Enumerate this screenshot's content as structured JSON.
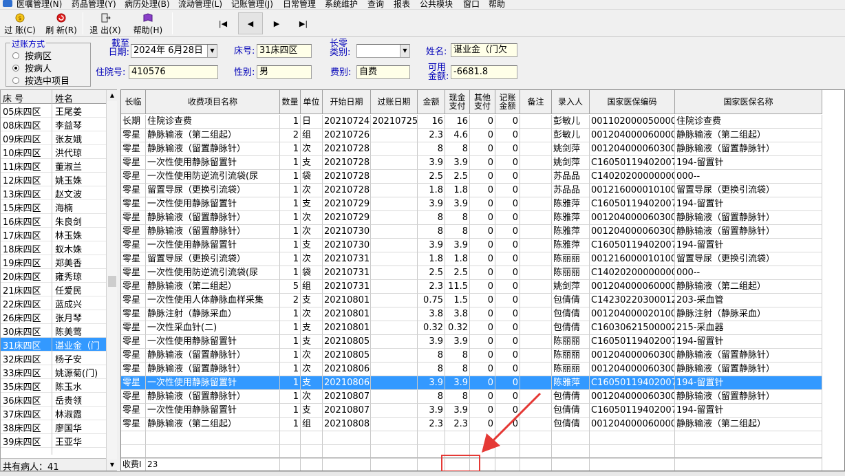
{
  "menu": [
    "医嘱管理(N)",
    "药品管理(Y)",
    "病历处理(B)",
    "流动管理(L)",
    "记账管理(J)",
    "日常管理",
    "系统维护",
    "查询",
    "报表",
    "公共模块",
    "窗口",
    "帮助"
  ],
  "toolbar": {
    "post_label": "过 账(C)",
    "refresh_label": "刷 新(R)",
    "exit_label": "退 出(X)",
    "help_label": "帮助(H)",
    "nav_first": "|◀",
    "nav_prev": "◀",
    "nav_next": "▶",
    "nav_last": "▶|"
  },
  "filters": {
    "mode_title": "过账方式",
    "mode_options": [
      "按病区",
      "按病人",
      "按选中项目"
    ],
    "mode_selected": 1,
    "cutoff_label": "截至日期:",
    "cutoff_value": "2024年 6月28日",
    "bed_label": "床号:",
    "bed_value": "31床四区",
    "longterm_label": "长零类别:",
    "longterm_value": "",
    "name_label": "姓名:",
    "name_value": "谌业金（门欠",
    "inpatient_label": "住院号:",
    "inpatient_value": "410576",
    "gender_label": "性别:",
    "gender_value": "男",
    "fee_label": "费别:",
    "fee_value": "自费",
    "balance_label": "可用金额:",
    "balance_value": "-6681.8"
  },
  "patients": {
    "headers": [
      "床 号",
      "姓名"
    ],
    "rows": [
      [
        "05床四区",
        "王尾姜"
      ],
      [
        "08床四区",
        "李益琴"
      ],
      [
        "09床四区",
        "张友娥"
      ],
      [
        "10床四区",
        "洪代琼"
      ],
      [
        "11床四区",
        "董淑兰"
      ],
      [
        "12床四区",
        "姚玉姝"
      ],
      [
        "13床四区",
        "赵文波"
      ],
      [
        "15床四区",
        "海楠"
      ],
      [
        "16床四区",
        "朱良剑"
      ],
      [
        "17床四区",
        "林玉姝"
      ],
      [
        "18床四区",
        "蚁木姝"
      ],
      [
        "19床四区",
        "郑美香"
      ],
      [
        "20床四区",
        "雍秀琼"
      ],
      [
        "21床四区",
        "任爱民"
      ],
      [
        "22床四区",
        "蓝成兴"
      ],
      [
        "26床四区",
        "张月琴"
      ],
      [
        "30床四区",
        "陈美莺"
      ],
      [
        "31床四区",
        "谌业金（门"
      ],
      [
        "32床四区",
        "杨子安"
      ],
      [
        "33床四区",
        "姚源菊(门)"
      ],
      [
        "35床四区",
        "陈玉水"
      ],
      [
        "36床四区",
        "岳贵领"
      ],
      [
        "37床四区",
        "林淑霞"
      ],
      [
        "38床四区",
        "廖国华"
      ],
      [
        "39床四区",
        "王亚华"
      ]
    ],
    "selected_index": 17,
    "total_label": "共有病人：41"
  },
  "grid": {
    "headers": [
      "长临",
      "收费项目名称",
      "数量",
      "单位",
      "开始日期",
      "过账日期",
      "金额",
      "现金支付",
      "其他支付",
      "记账金额",
      "备注",
      "录入人",
      "国家医保编码",
      "国家医保名称"
    ],
    "rows": [
      [
        "长期",
        "住院诊查费",
        "1",
        "日",
        "20210724",
        "20210725",
        "16",
        "16",
        "0",
        "0",
        "",
        "彭敏儿",
        "001102000050000",
        "住院诊查费"
      ],
      [
        "零星",
        "静脉输液（第二组起）",
        "2",
        "组",
        "20210726",
        "",
        "2.3",
        "4.6",
        "0",
        "0",
        "",
        "彭敏儿",
        "001204000060000",
        "静脉输液（第二组起）"
      ],
      [
        "零星",
        "静脉输液（留置静脉针）",
        "1",
        "次",
        "20210728",
        "",
        "8",
        "8",
        "0",
        "0",
        "",
        "姚剑萍",
        "001204000060300",
        "静脉输液（留置静脉针）"
      ],
      [
        "零星",
        "一次性使用静脉留置针",
        "1",
        "支",
        "20210728",
        "",
        "3.9",
        "3.9",
        "0",
        "0",
        "",
        "姚剑萍",
        "C16050119402007",
        "194-留置针"
      ],
      [
        "零星",
        "一次性使用防逆流引流袋(尿",
        "1",
        "袋",
        "20210728",
        "",
        "2.5",
        "2.5",
        "0",
        "0",
        "",
        "苏品品",
        "C14020200000000",
        "000--"
      ],
      [
        "零星",
        "留置导尿（更换引流袋）",
        "1",
        "次",
        "20210728",
        "",
        "1.8",
        "1.8",
        "0",
        "0",
        "",
        "苏品品",
        "001216000010100",
        "留置导尿（更换引流袋）"
      ],
      [
        "零星",
        "一次性使用静脉留置针",
        "1",
        "支",
        "20210729",
        "",
        "3.9",
        "3.9",
        "0",
        "0",
        "",
        "陈雅萍",
        "C16050119402007",
        "194-留置针"
      ],
      [
        "零星",
        "静脉输液（留置静脉针）",
        "1",
        "次",
        "20210729",
        "",
        "8",
        "8",
        "0",
        "0",
        "",
        "陈雅萍",
        "001204000060300",
        "静脉输液（留置静脉针）"
      ],
      [
        "零星",
        "静脉输液（留置静脉针）",
        "1",
        "次",
        "20210730",
        "",
        "8",
        "8",
        "0",
        "0",
        "",
        "陈雅萍",
        "001204000060300",
        "静脉输液（留置静脉针）"
      ],
      [
        "零星",
        "一次性使用静脉留置针",
        "1",
        "支",
        "20210730",
        "",
        "3.9",
        "3.9",
        "0",
        "0",
        "",
        "陈雅萍",
        "C16050119402007",
        "194-留置针"
      ],
      [
        "零星",
        "留置导尿（更换引流袋）",
        "1",
        "次",
        "20210731",
        "",
        "1.8",
        "1.8",
        "0",
        "0",
        "",
        "陈丽丽",
        "001216000010100",
        "留置导尿（更换引流袋）"
      ],
      [
        "零星",
        "一次性使用防逆流引流袋(尿",
        "1",
        "袋",
        "20210731",
        "",
        "2.5",
        "2.5",
        "0",
        "0",
        "",
        "陈丽丽",
        "C14020200000000",
        "000--"
      ],
      [
        "零星",
        "静脉输液（第二组起）",
        "5",
        "组",
        "20210731",
        "",
        "2.3",
        "11.5",
        "0",
        "0",
        "",
        "姚剑萍",
        "001204000060000",
        "静脉输液（第二组起）"
      ],
      [
        "零星",
        "一次性使用人体静脉血样采集",
        "2",
        "支",
        "20210801",
        "",
        "0.75",
        "1.5",
        "0",
        "0",
        "",
        "包倩倩",
        "C14230220300012",
        "203-采血管"
      ],
      [
        "零星",
        "静脉注射（静脉采血）",
        "1",
        "次",
        "20210801",
        "",
        "3.8",
        "3.8",
        "0",
        "0",
        "",
        "包倩倩",
        "001204000020100",
        "静脉注射（静脉采血）"
      ],
      [
        "零星",
        "一次性采血针(二)",
        "1",
        "支",
        "20210801",
        "",
        "0.32",
        "0.32",
        "0",
        "0",
        "",
        "包倩倩",
        "C16030621500002",
        "215-采血器"
      ],
      [
        "零星",
        "一次性使用静脉留置针",
        "1",
        "支",
        "20210805",
        "",
        "3.9",
        "3.9",
        "0",
        "0",
        "",
        "陈丽丽",
        "C16050119402007",
        "194-留置针"
      ],
      [
        "零星",
        "静脉输液（留置静脉针）",
        "1",
        "次",
        "20210805",
        "",
        "8",
        "8",
        "0",
        "0",
        "",
        "陈丽丽",
        "001204000060300",
        "静脉输液（留置静脉针）"
      ],
      [
        "零星",
        "静脉输液（留置静脉针）",
        "1",
        "次",
        "20210806",
        "",
        "8",
        "8",
        "0",
        "0",
        "",
        "陈丽丽",
        "001204000060300",
        "静脉输液（留置静脉针）"
      ],
      [
        "零星",
        "一次性使用静脉留置针",
        "1",
        "支",
        "20210806",
        "",
        "3.9",
        "3.9",
        "0",
        "0",
        "",
        "陈雅萍",
        "C16050119402007",
        "194-留置针"
      ],
      [
        "零星",
        "静脉输液（留置静脉针）",
        "1",
        "次",
        "20210807",
        "",
        "8",
        "8",
        "0",
        "0",
        "",
        "包倩倩",
        "001204000060300",
        "静脉输液（留置静脉针）"
      ],
      [
        "零星",
        "一次性使用静脉留置针",
        "1",
        "支",
        "20210807",
        "",
        "3.9",
        "3.9",
        "0",
        "0",
        "",
        "包倩倩",
        "C16050119402007",
        "194-留置针"
      ],
      [
        "零星",
        "静脉输液（第二组起）",
        "1",
        "组",
        "20210808",
        "",
        "2.3",
        "2.3",
        "0",
        "0",
        "",
        "包倩倩",
        "001204000060000",
        "静脉输液（第二组起）"
      ]
    ],
    "selected_index": 19,
    "footer_label": "收费I",
    "footer_count": "23"
  },
  "colors": {
    "selection": "#3399ff",
    "label_blue": "#0000b8",
    "field_bg": "#ffffe8",
    "annotation_red": "#e53935"
  },
  "icons": {
    "post": "coin-icon",
    "refresh": "refresh-icon",
    "exit": "exit-door-icon",
    "help": "book-icon"
  }
}
